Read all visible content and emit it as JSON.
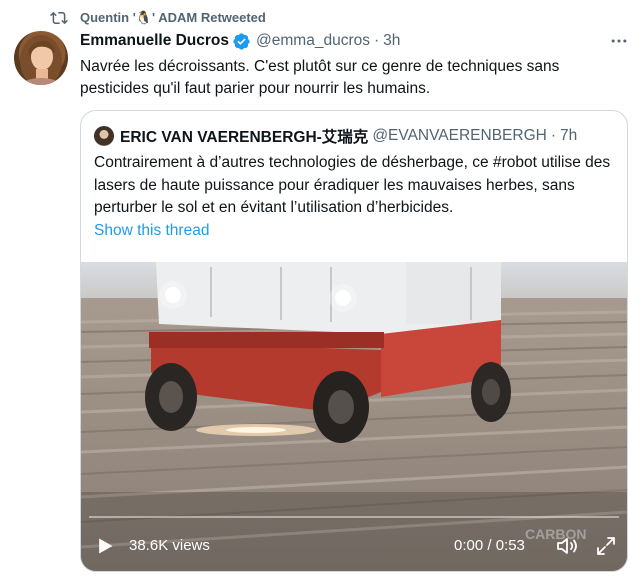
{
  "retweet": {
    "label": "Quentin '🐧' ADAM Retweeted"
  },
  "tweet": {
    "author_name": "Emmanuelle Ducros",
    "handle": "@emma_ducros",
    "separator": "·",
    "time": "3h",
    "text": "Navrée les décroissants. C'est plutôt sur ce genre de techniques sans pesticides qu'il faut parier pour nourrir les humains."
  },
  "quote": {
    "author_name": "ERIC VAN VAERENBERGH-艾瑞克",
    "handle": "@EVANVAERENBERGH",
    "separator": "·",
    "time": "7h",
    "text": "Contrairement à d’autres technologies de désherbage, ce #robot utilise des lasers de haute puissance pour éradiquer les mauvaises herbes, sans perturber le sol et en évitant l’utilisation d’herbicides.",
    "show_thread": "Show this thread"
  },
  "video": {
    "views": "38.6K views",
    "time": "0:00 / 0:53",
    "progress": 0,
    "watermark": "CARBON"
  },
  "colors": {
    "link": "#1d9bf0",
    "secondary_text": "#536471",
    "verified": "#1d9bf0",
    "border": "#cfd9de"
  },
  "icons": [
    "retweet-icon",
    "verified-badge-icon",
    "more-icon",
    "play-icon",
    "volume-icon",
    "fullscreen-icon"
  ]
}
